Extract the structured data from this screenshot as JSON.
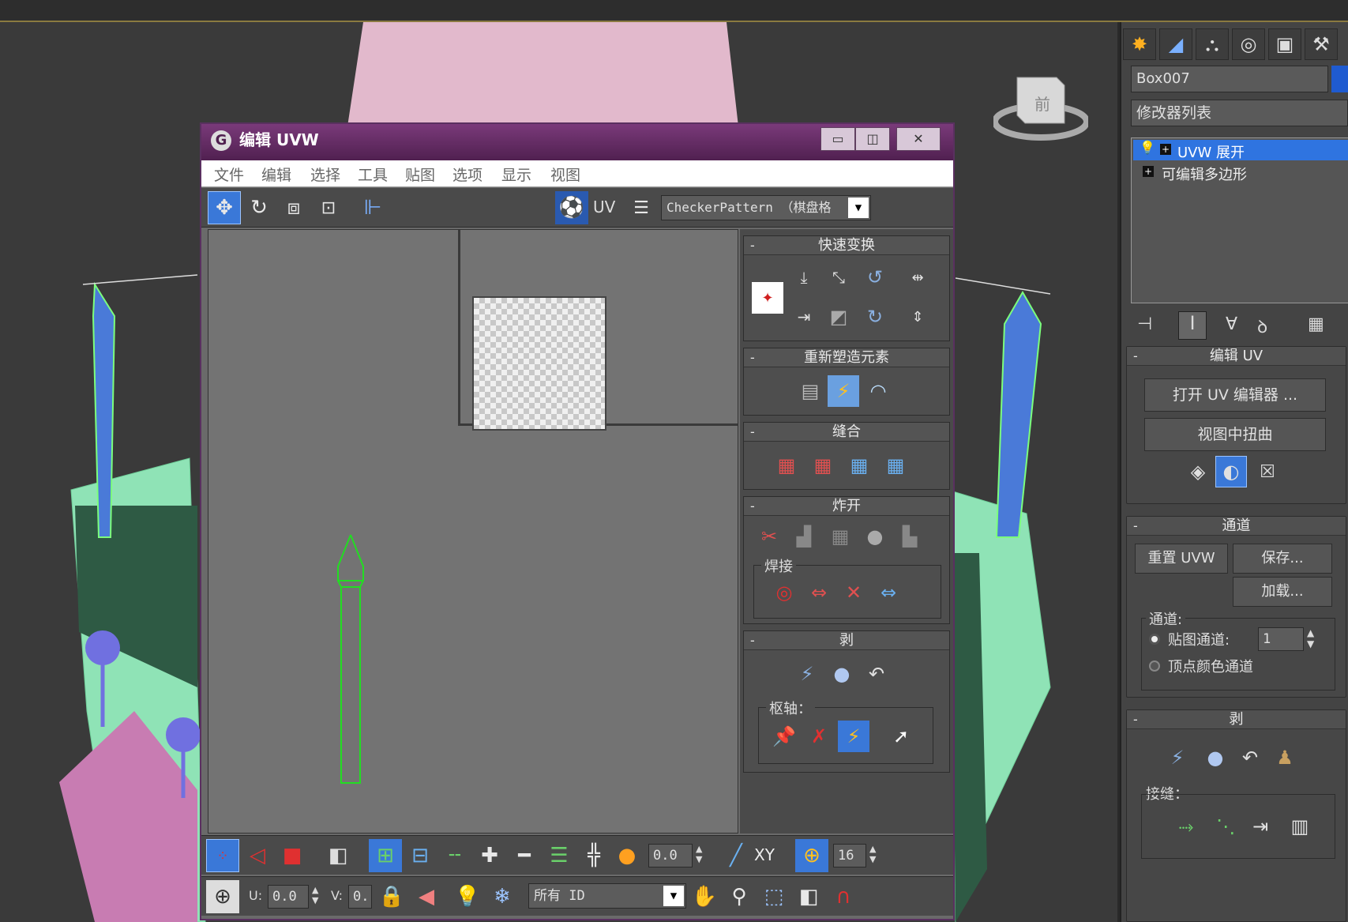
{
  "uv_editor": {
    "title": "编辑 UVW",
    "menu": [
      "文件",
      "编辑",
      "选择",
      "工具",
      "贴图",
      "选项",
      "显示",
      "视图"
    ],
    "uv_label": "UV",
    "texture_dropdown": "CheckerPattern （棋盘格",
    "sections": {
      "quick_transform": "快速变换",
      "reshape": "重新塑造元素",
      "stitch": "缝合",
      "explode": "炸开",
      "weld": "焊接",
      "peel": "剥",
      "pivot": "枢轴："
    },
    "bottom": {
      "threshold": "0.0",
      "xy_label": "XY",
      "grid_value": "16",
      "u_label": "U:",
      "u_value": "0.0",
      "v_label": "V:",
      "v_value": "0.",
      "id_dropdown": "所有 ID"
    }
  },
  "command_panel": {
    "object_name": "Box007",
    "modifier_list_label": "修改器列表",
    "stack": [
      {
        "label": "UVW 展开",
        "selected": true
      },
      {
        "label": "可编辑多边形",
        "selected": false
      }
    ],
    "edit_uv": {
      "title": "编辑 UV",
      "open_editor": "打开 UV 编辑器 ...",
      "tweak_in_view": "视图中扭曲"
    },
    "channel": {
      "title": "通道",
      "reset_uvw": "重置 UVW",
      "save": "保存...",
      "load": "加载...",
      "group_label": "通道:",
      "map_channel_label": "贴图通道:",
      "map_channel_value": "1",
      "vertex_color_label": "顶点颜色通道"
    },
    "peel": {
      "title": "剥",
      "seams_label": "接缝："
    }
  },
  "viewcube": {
    "label": "前"
  },
  "colors": {
    "selection_blue": "#3a78d8",
    "title_purple": "#6a2a6a",
    "uv_green": "#22dd22",
    "mesh_mint": "#8ee4b8",
    "mesh_pink": "#e4b8cc"
  }
}
